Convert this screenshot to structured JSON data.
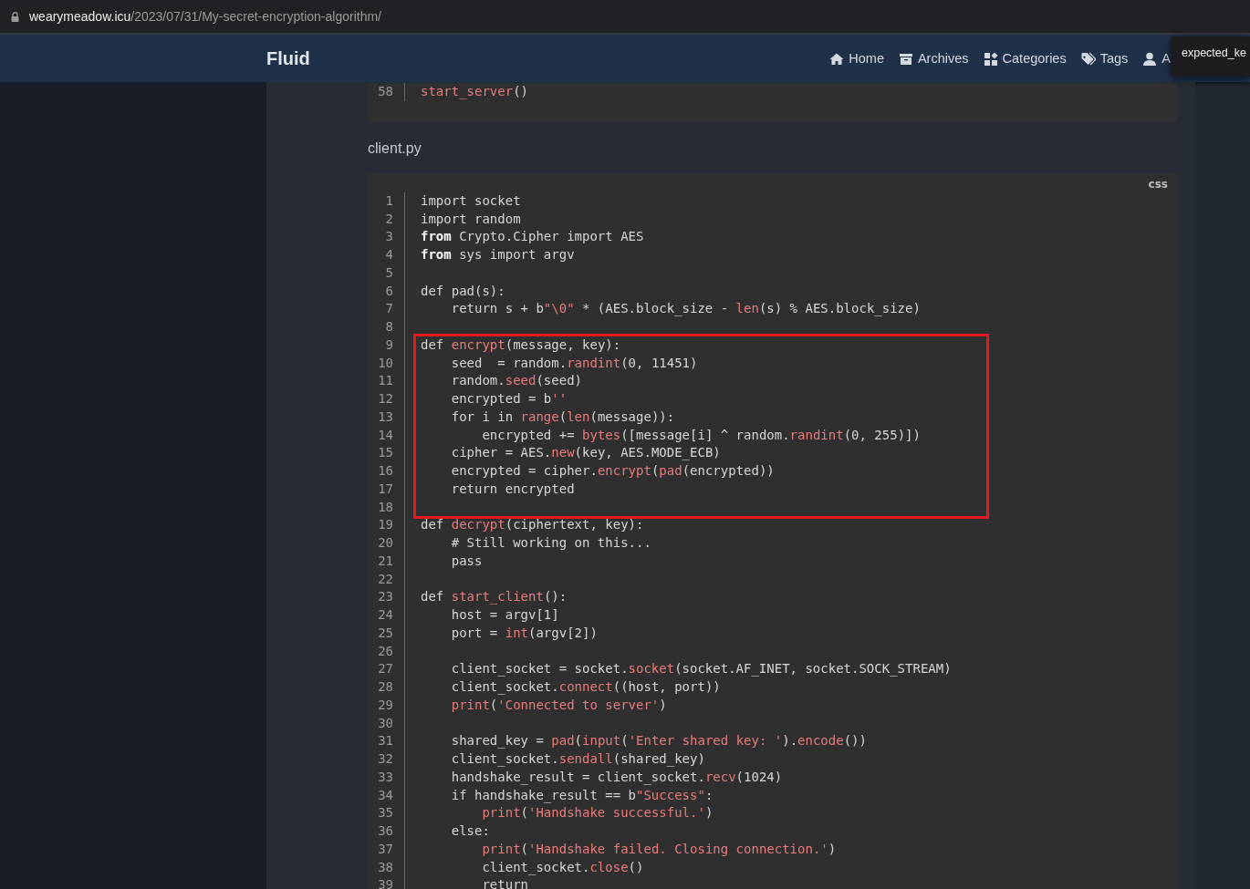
{
  "browser": {
    "url_host": "wearymeadow.icu",
    "url_path": "/2023/07/31/My-secret-encryption-algorithm/"
  },
  "navbar": {
    "brand": "Fluid",
    "items": [
      {
        "label": "Home"
      },
      {
        "label": "Archives"
      },
      {
        "label": "Categories"
      },
      {
        "label": "Tags"
      },
      {
        "label": "A"
      }
    ]
  },
  "tooltip": {
    "text": "expected_ke"
  },
  "previous_block": {
    "sections": [
      {
        "boxed": false,
        "lines": [
          {
            "n": "58",
            "segs": [
              {
                "kind": "fn",
                "text": "start_server"
              },
              {
                "kind": "p",
                "text": "()"
              }
            ]
          }
        ]
      }
    ]
  },
  "file_heading": "client.py",
  "code_block": {
    "language": "css",
    "sections": [
      {
        "boxed": false,
        "lines": [
          {
            "n": "1",
            "segs": [
              {
                "kind": "p",
                "text": "import socket"
              }
            ]
          },
          {
            "n": "2",
            "segs": [
              {
                "kind": "p",
                "text": "import random"
              }
            ]
          },
          {
            "n": "3",
            "segs": [
              {
                "kind": "kw",
                "text": "from"
              },
              {
                "kind": "p",
                "text": " Crypto.Cipher import AES"
              }
            ]
          },
          {
            "n": "4",
            "segs": [
              {
                "kind": "kw",
                "text": "from"
              },
              {
                "kind": "p",
                "text": " sys import argv"
              }
            ]
          },
          {
            "n": "5"
          },
          {
            "n": "6",
            "segs": [
              {
                "kind": "p",
                "text": "def pad(s):"
              }
            ]
          },
          {
            "n": "7",
            "segs": [
              {
                "kind": "p",
                "text": "    return s + b"
              },
              {
                "kind": "str",
                "text": "\"\\0\""
              },
              {
                "kind": "p",
                "text": " * (AES.block_size - "
              },
              {
                "kind": "fn",
                "text": "len"
              },
              {
                "kind": "p",
                "text": "(s) % AES.block_size)"
              }
            ]
          },
          {
            "n": "8"
          }
        ]
      },
      {
        "boxed": true,
        "lines": [
          {
            "n": "9",
            "segs": [
              {
                "kind": "p",
                "text": "def "
              },
              {
                "kind": "fn",
                "text": "encrypt"
              },
              {
                "kind": "p",
                "text": "(message, key):"
              }
            ]
          },
          {
            "n": "10",
            "segs": [
              {
                "kind": "p",
                "text": "    seed  = random."
              },
              {
                "kind": "fn",
                "text": "randint"
              },
              {
                "kind": "p",
                "text": "(0, 11451)"
              }
            ]
          },
          {
            "n": "11",
            "segs": [
              {
                "kind": "p",
                "text": "    random."
              },
              {
                "kind": "fn",
                "text": "seed"
              },
              {
                "kind": "p",
                "text": "(seed)"
              }
            ]
          },
          {
            "n": "12",
            "segs": [
              {
                "kind": "p",
                "text": "    encrypted = b"
              },
              {
                "kind": "str",
                "text": "''"
              }
            ]
          },
          {
            "n": "13",
            "segs": [
              {
                "kind": "p",
                "text": "    for i in "
              },
              {
                "kind": "fn",
                "text": "range"
              },
              {
                "kind": "p",
                "text": "("
              },
              {
                "kind": "fn",
                "text": "len"
              },
              {
                "kind": "p",
                "text": "(message)):"
              }
            ]
          },
          {
            "n": "14",
            "segs": [
              {
                "kind": "p",
                "text": "        encrypted += "
              },
              {
                "kind": "fn",
                "text": "bytes"
              },
              {
                "kind": "p",
                "text": "([message[i] ^ random."
              },
              {
                "kind": "fn",
                "text": "randint"
              },
              {
                "kind": "p",
                "text": "(0, 255)])"
              }
            ]
          },
          {
            "n": "15",
            "segs": [
              {
                "kind": "p",
                "text": "    cipher = AES."
              },
              {
                "kind": "fn",
                "text": "new"
              },
              {
                "kind": "p",
                "text": "(key, AES.MODE_ECB)"
              }
            ]
          },
          {
            "n": "16",
            "segs": [
              {
                "kind": "p",
                "text": "    encrypted = cipher."
              },
              {
                "kind": "fn",
                "text": "encrypt"
              },
              {
                "kind": "p",
                "text": "("
              },
              {
                "kind": "fn",
                "text": "pad"
              },
              {
                "kind": "p",
                "text": "(encrypted))"
              }
            ]
          },
          {
            "n": "17",
            "segs": [
              {
                "kind": "p",
                "text": "    return encrypted"
              }
            ]
          },
          {
            "n": "18"
          }
        ]
      },
      {
        "boxed": false,
        "lines": [
          {
            "n": "19",
            "segs": [
              {
                "kind": "p",
                "text": "def "
              },
              {
                "kind": "fn",
                "text": "decrypt"
              },
              {
                "kind": "p",
                "text": "(ciphertext, key):"
              }
            ]
          },
          {
            "n": "20",
            "segs": [
              {
                "kind": "p",
                "text": "    # Still working on this..."
              }
            ]
          },
          {
            "n": "21",
            "segs": [
              {
                "kind": "p",
                "text": "    pass"
              }
            ]
          },
          {
            "n": "22"
          },
          {
            "n": "23",
            "segs": [
              {
                "kind": "p",
                "text": "def "
              },
              {
                "kind": "fn",
                "text": "start_client"
              },
              {
                "kind": "p",
                "text": "():"
              }
            ]
          },
          {
            "n": "24",
            "segs": [
              {
                "kind": "p",
                "text": "    host = argv[1]"
              }
            ]
          },
          {
            "n": "25",
            "segs": [
              {
                "kind": "p",
                "text": "    port = "
              },
              {
                "kind": "fn",
                "text": "int"
              },
              {
                "kind": "p",
                "text": "(argv[2])"
              }
            ]
          },
          {
            "n": "26"
          },
          {
            "n": "27",
            "segs": [
              {
                "kind": "p",
                "text": "    client_socket = socket."
              },
              {
                "kind": "fn",
                "text": "socket"
              },
              {
                "kind": "p",
                "text": "(socket.AF_INET, socket.SOCK_STREAM)"
              }
            ]
          },
          {
            "n": "28",
            "segs": [
              {
                "kind": "p",
                "text": "    client_socket."
              },
              {
                "kind": "fn",
                "text": "connect"
              },
              {
                "kind": "p",
                "text": "((host, port))"
              }
            ]
          },
          {
            "n": "29",
            "segs": [
              {
                "kind": "fn",
                "text": "    print"
              },
              {
                "kind": "p",
                "text": "("
              },
              {
                "kind": "str",
                "text": "'Connected to server'"
              },
              {
                "kind": "p",
                "text": ")"
              }
            ]
          },
          {
            "n": "30"
          },
          {
            "n": "31",
            "segs": [
              {
                "kind": "p",
                "text": "    shared_key = "
              },
              {
                "kind": "fn",
                "text": "pad"
              },
              {
                "kind": "p",
                "text": "("
              },
              {
                "kind": "fn",
                "text": "input"
              },
              {
                "kind": "p",
                "text": "("
              },
              {
                "kind": "str",
                "text": "'Enter shared key: '"
              },
              {
                "kind": "p",
                "text": ")."
              },
              {
                "kind": "fn",
                "text": "encode"
              },
              {
                "kind": "p",
                "text": "())"
              }
            ]
          },
          {
            "n": "32",
            "segs": [
              {
                "kind": "p",
                "text": "    client_socket."
              },
              {
                "kind": "fn",
                "text": "sendall"
              },
              {
                "kind": "p",
                "text": "(shared_key)"
              }
            ]
          },
          {
            "n": "33",
            "segs": [
              {
                "kind": "p",
                "text": "    handshake_result = client_socket."
              },
              {
                "kind": "fn",
                "text": "recv"
              },
              {
                "kind": "p",
                "text": "(1024)"
              }
            ]
          },
          {
            "n": "34",
            "segs": [
              {
                "kind": "p",
                "text": "    if handshake_result == b"
              },
              {
                "kind": "str",
                "text": "\"Success\""
              },
              {
                "kind": "p",
                "text": ":"
              }
            ]
          },
          {
            "n": "35",
            "segs": [
              {
                "kind": "fn",
                "text": "        print"
              },
              {
                "kind": "p",
                "text": "("
              },
              {
                "kind": "str",
                "text": "'Handshake successful.'"
              },
              {
                "kind": "p",
                "text": ")"
              }
            ]
          },
          {
            "n": "36",
            "segs": [
              {
                "kind": "p",
                "text": "    else:"
              }
            ]
          },
          {
            "n": "37",
            "segs": [
              {
                "kind": "fn",
                "text": "        print"
              },
              {
                "kind": "p",
                "text": "("
              },
              {
                "kind": "str",
                "text": "'Handshake failed. Closing connection.'"
              },
              {
                "kind": "p",
                "text": ")"
              }
            ]
          },
          {
            "n": "38",
            "segs": [
              {
                "kind": "p",
                "text": "        client_socket."
              },
              {
                "kind": "fn",
                "text": "close"
              },
              {
                "kind": "p",
                "text": "()"
              }
            ]
          },
          {
            "n": "39",
            "segs": [
              {
                "kind": "p",
                "text": "        return"
              }
            ]
          }
        ]
      }
    ]
  }
}
